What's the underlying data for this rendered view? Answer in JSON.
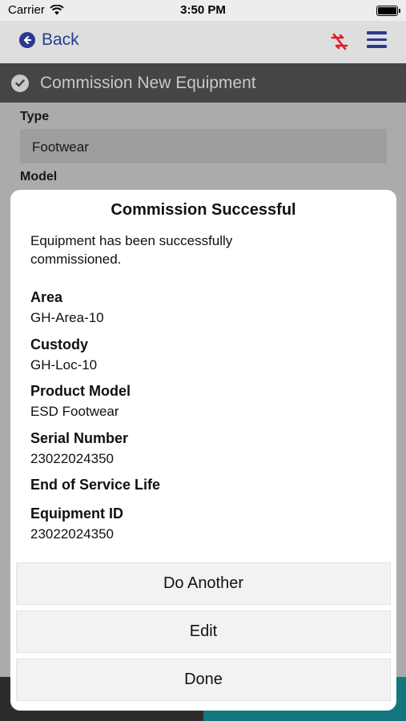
{
  "status_bar": {
    "carrier": "Carrier",
    "time": "3:50 PM"
  },
  "nav": {
    "back_label": "Back",
    "icons": [
      "sync-off-icon",
      "menu-icon"
    ],
    "accent_color": "#2b3a8f",
    "alert_color": "#e21b23"
  },
  "header": {
    "title": "Commission New Equipment"
  },
  "form": {
    "type_label": "Type",
    "type_value": "Footwear",
    "model_label": "Model"
  },
  "modal": {
    "title": "Commission Successful",
    "message": "Equipment has been successfully commissioned.",
    "details": [
      {
        "label": "Area",
        "value": "GH-Area-10"
      },
      {
        "label": "Custody",
        "value": "GH-Loc-10"
      },
      {
        "label": "Product Model",
        "value": "ESD Footwear"
      },
      {
        "label": "Serial Number",
        "value": "23022024350"
      },
      {
        "label": "End of Service Life",
        "value": ""
      },
      {
        "label": "Equipment ID",
        "value": "23022024350"
      }
    ],
    "buttons": {
      "do_another": "Do Another",
      "edit": "Edit",
      "done": "Done"
    }
  }
}
